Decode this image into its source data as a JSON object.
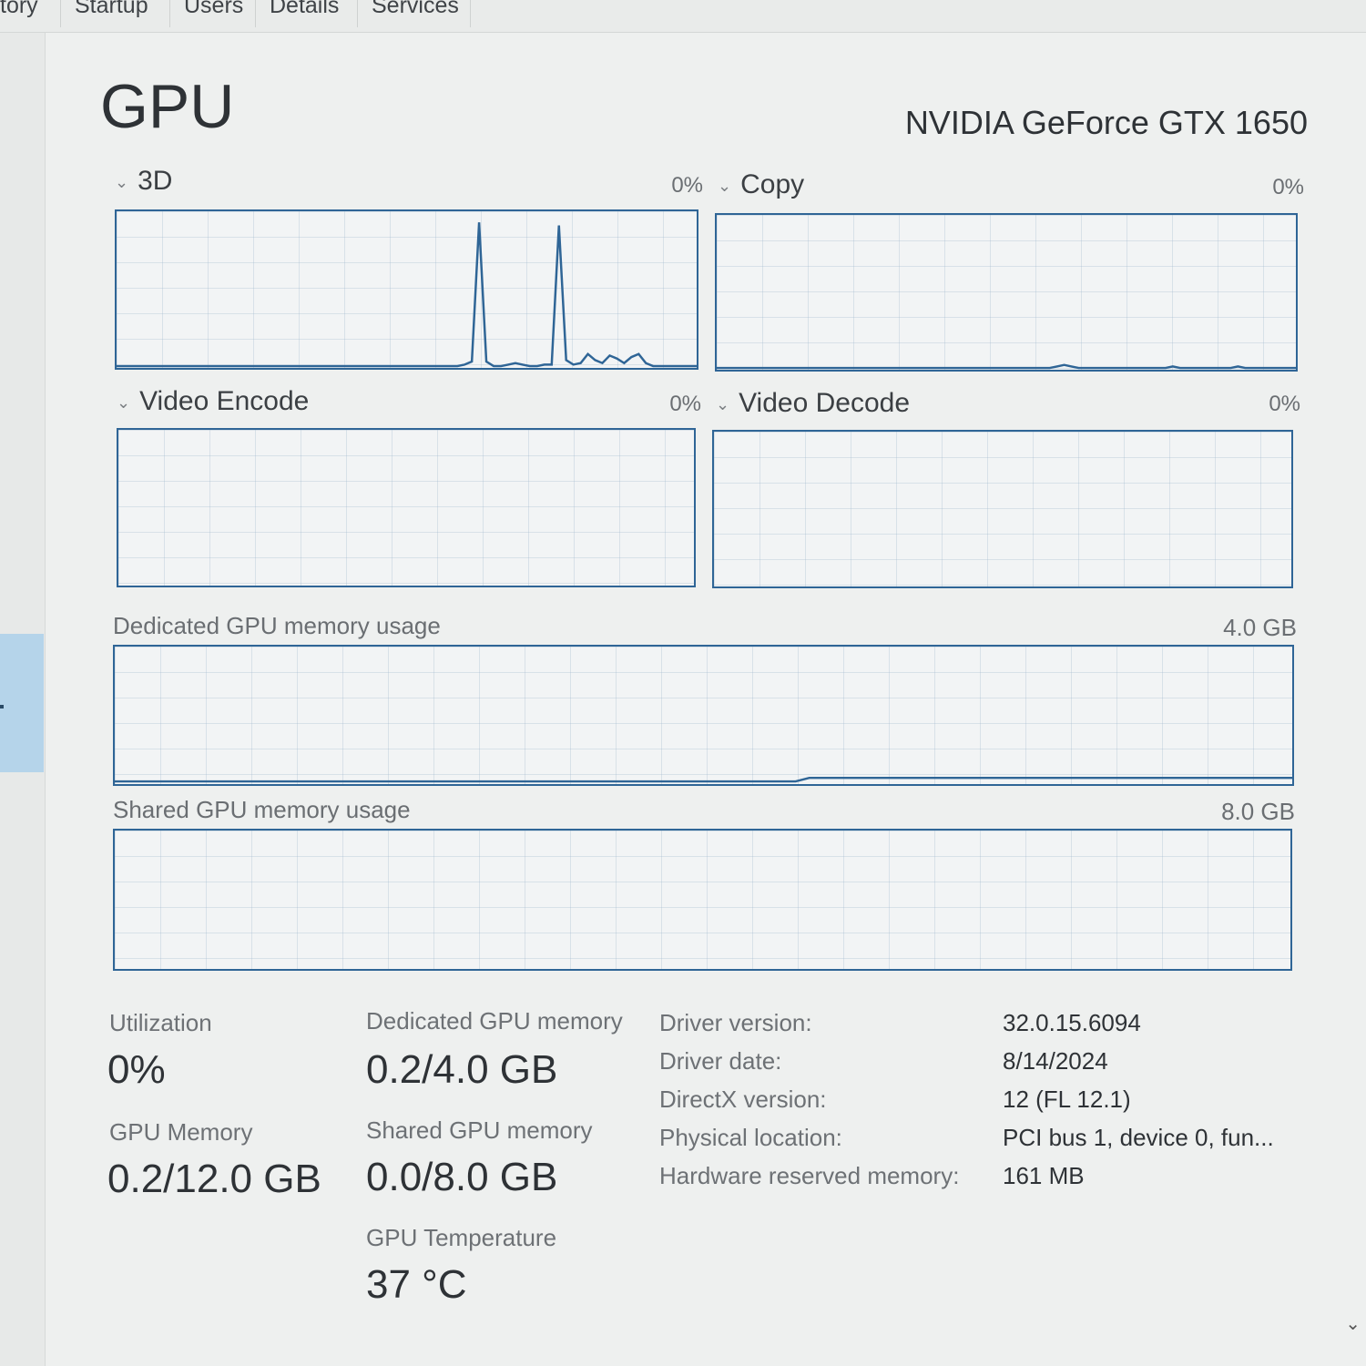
{
  "tabs": [
    {
      "label": "tory"
    },
    {
      "label": "Startup"
    },
    {
      "label": "Users"
    },
    {
      "label": "Details"
    },
    {
      "label": "Services"
    }
  ],
  "header": {
    "title": "GPU",
    "gpu_name": "NVIDIA GeForce GTX 1650"
  },
  "engines": [
    {
      "name": "3D",
      "value": "0%",
      "trace": [
        0,
        0,
        0,
        0,
        0,
        0,
        0,
        0,
        0,
        0,
        0,
        0,
        0,
        0,
        0,
        0,
        0,
        0,
        0,
        0,
        0,
        0,
        0,
        0,
        0,
        0,
        0,
        0,
        0,
        0,
        0,
        0,
        0,
        0,
        0,
        0,
        0,
        0,
        0,
        0,
        0,
        0,
        0,
        0,
        0,
        0,
        0,
        0,
        1,
        3,
        95,
        3,
        0,
        0,
        1,
        2,
        1,
        0,
        0,
        1,
        1,
        93,
        4,
        1,
        2,
        8,
        4,
        2,
        7,
        5,
        2,
        6,
        8,
        2,
        0,
        0,
        0,
        0,
        0,
        0,
        0
      ]
    },
    {
      "name": "Copy",
      "value": "0%",
      "trace": [
        0,
        0,
        0,
        0,
        0,
        0,
        0,
        0,
        0,
        0,
        0,
        0,
        0,
        0,
        0,
        0,
        0,
        0,
        0,
        0,
        0,
        0,
        0,
        0,
        0,
        0,
        0,
        0,
        0,
        0,
        0,
        0,
        0,
        0,
        0,
        0,
        0,
        0,
        0,
        0,
        0,
        0,
        0,
        0,
        0,
        0,
        0,
        1,
        2,
        1,
        0,
        0,
        0,
        0,
        0,
        0,
        0,
        0,
        0,
        0,
        0,
        0,
        0,
        1,
        0,
        0,
        0,
        0,
        0,
        0,
        0,
        0,
        1,
        0,
        0,
        0,
        0,
        0,
        0,
        0,
        0
      ]
    },
    {
      "name": "Video Encode",
      "value": "0%",
      "trace": []
    },
    {
      "name": "Video Decode",
      "value": "0%",
      "trace": []
    }
  ],
  "dedicated_graph": {
    "label": "Dedicated GPU memory usage",
    "max": "4.0 GB",
    "trace": [
      0,
      0,
      0,
      0,
      0,
      0,
      0,
      0,
      0,
      0,
      0,
      0,
      0,
      0,
      0,
      0,
      0,
      0,
      0,
      0,
      0,
      0,
      0,
      0,
      0,
      0,
      0,
      0,
      0,
      0,
      0,
      0,
      0,
      0,
      0,
      0,
      0,
      0,
      0,
      0,
      0,
      0,
      0,
      0,
      0,
      0,
      0,
      0,
      0,
      0,
      0,
      0,
      0,
      0,
      0,
      0,
      0,
      0,
      0,
      0,
      0,
      0,
      0,
      0,
      0,
      0,
      0,
      0,
      0,
      0,
      0,
      0,
      0,
      0,
      0,
      0,
      0,
      0,
      0,
      0,
      0
    ]
  },
  "shared_graph": {
    "label": "Shared GPU memory usage",
    "max": "8.0 GB"
  },
  "stats": {
    "utilization_label": "Utilization",
    "utilization_value": "0%",
    "gpu_memory_label": "GPU Memory",
    "gpu_memory_value": "0.2/12.0 GB",
    "dedicated_label": "Dedicated GPU memory",
    "dedicated_value": "0.2/4.0 GB",
    "shared_label": "Shared GPU memory",
    "shared_value": "0.0/8.0 GB",
    "temp_label": "GPU Temperature",
    "temp_value": "37 °C"
  },
  "info": [
    {
      "label": "Driver version:",
      "value": "32.0.15.6094"
    },
    {
      "label": "Driver date:",
      "value": "8/14/2024"
    },
    {
      "label": "DirectX version:",
      "value": "12 (FL 12.1)"
    },
    {
      "label": "Physical location:",
      "value": "PCI bus 1, device 0, fun..."
    },
    {
      "label": "Hardware reserved memory:",
      "value": "161 MB"
    }
  ],
  "colors": {
    "graph_line": "#2f6596",
    "selected_nav": "#b5d4ea"
  }
}
